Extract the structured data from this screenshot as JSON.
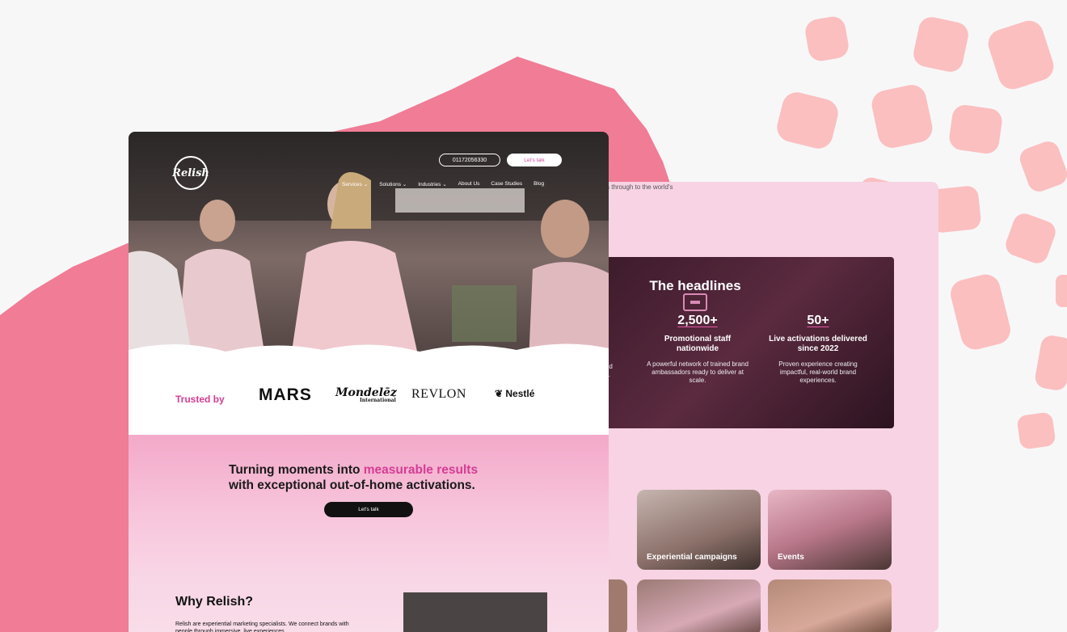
{
  "header": {
    "logo_text": "Relish",
    "phone": "01172056330",
    "cta_label": "Let's talk",
    "nav": [
      "Services",
      "Solutions",
      "Industries",
      "About Us",
      "Case Studies",
      "Blog"
    ],
    "nav_dropdowns": [
      true,
      true,
      true,
      false,
      false,
      false
    ]
  },
  "trusted": {
    "label": "Trusted by",
    "brands": [
      "MARS",
      "Mondelēz",
      "REVLON",
      "Nestlé"
    ],
    "brand_sublabel": "International"
  },
  "hero_tagline": {
    "line1_prefix": "Turning moments into ",
    "highlight": "measurable results",
    "line2": "with exceptional out-of-home activations.",
    "cta_label": "Let's talk"
  },
  "why": {
    "title": "Why Relish?",
    "text": "Relish are experiential marketing specialists. We connect brands with people through immersive, live experiences"
  },
  "back_page": {
    "top_snippet": "s through to the world's",
    "headlines_title": "The headlines",
    "partial_left_label": "ial",
    "partial_left_desc": ", and\ntion.",
    "stats": [
      {
        "num": "2,500+",
        "label": "Promotional staff nationwide",
        "desc": "A powerful network of trained brand ambassadors ready to deliver at scale."
      },
      {
        "num": "50+",
        "label": "Live activations delivered since 2022",
        "desc": "Proven experience creating impactful, real-world brand experiences."
      }
    ],
    "tiles": [
      "Experiential campaigns",
      "Events"
    ]
  },
  "colors": {
    "brand_pink": "#d63c95",
    "splash_pink": "#f07c95",
    "blob_pink": "#fbbfc0",
    "back_pink": "#f7d3e3"
  }
}
